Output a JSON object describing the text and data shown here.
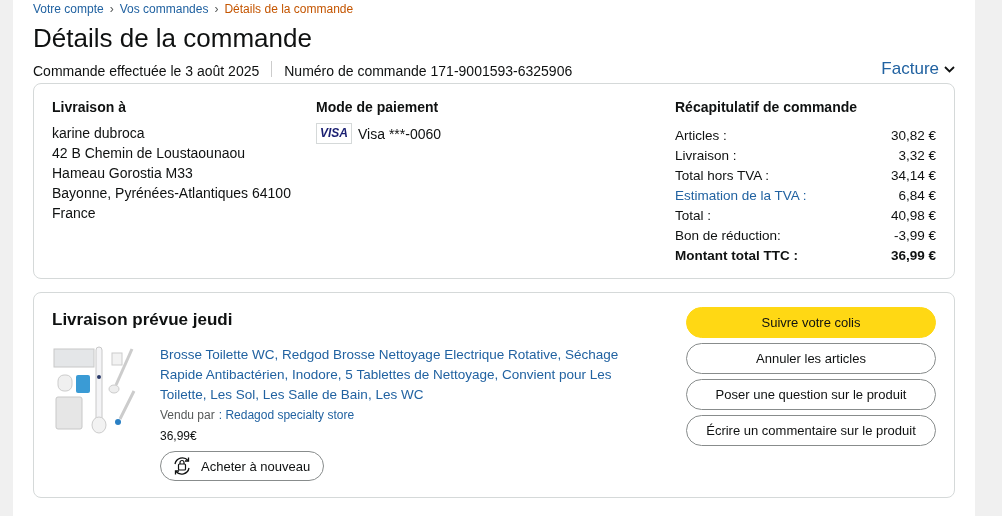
{
  "breadcrumb": {
    "separator": "›",
    "items": [
      {
        "label": "Votre compte",
        "current": false
      },
      {
        "label": "Vos commandes",
        "current": false
      },
      {
        "label": "Détails de la commande",
        "current": true
      }
    ]
  },
  "title": "Détails de la commande",
  "order_date": "Commande effectuée le 3 août 2025",
  "order_number": "Numéro de commande 171-9001593-6325906",
  "invoice_link": "Facture",
  "shipping": {
    "heading": "Livraison à",
    "lines": [
      "karine dubroca",
      "42 B Chemin de Loustaounaou",
      "Hameau Gorostia M33",
      "Bayonne, Pyrénées-Atlantiques 64100",
      "France"
    ]
  },
  "payment": {
    "heading": "Mode de paiement",
    "card_brand": "VISA",
    "card": "Visa ***-0060"
  },
  "summary": {
    "heading": "Récapitulatif de commande",
    "rows": [
      {
        "label": "Articles :",
        "value": "30,82 €",
        "kind": "plain"
      },
      {
        "label": "Livraison :",
        "value": "3,32 €",
        "kind": "plain"
      },
      {
        "label": "Total hors TVA :",
        "value": "34,14 €",
        "kind": "plain"
      },
      {
        "label": "Estimation de la TVA :",
        "value": "6,84 €",
        "kind": "link"
      },
      {
        "label": "Total :",
        "value": "40,98 €",
        "kind": "plain"
      },
      {
        "label": "Bon de réduction:",
        "value": "-3,99 €",
        "kind": "plain"
      },
      {
        "label": "Montant total TTC :",
        "value": "36,99 €",
        "kind": "total"
      }
    ]
  },
  "shipment": {
    "heading": "Livraison prévue jeudi",
    "product": {
      "title": "Brosse Toilette WC, Redgod Brosse Nettoyage Electrique Rotative, Séchage Rapide Antibactérien, Inodore, 5 Tablettes de Nettoyage, Convient pour Les Toilette, Les Sol, Les Salle de Bain, Les WC",
      "seller_label": "Vendu par",
      "seller": ": Redagod specialty store",
      "price": "36,99€",
      "buy_again": "Acheter à nouveau"
    },
    "actions": [
      {
        "label": "Suivre votre colis",
        "kind": "primary"
      },
      {
        "label": "Annuler les articles",
        "kind": "secondary"
      },
      {
        "label": "Poser une question sur le produit",
        "kind": "secondary"
      },
      {
        "label": "Écrire un commentaire sur le produit",
        "kind": "secondary"
      }
    ]
  }
}
